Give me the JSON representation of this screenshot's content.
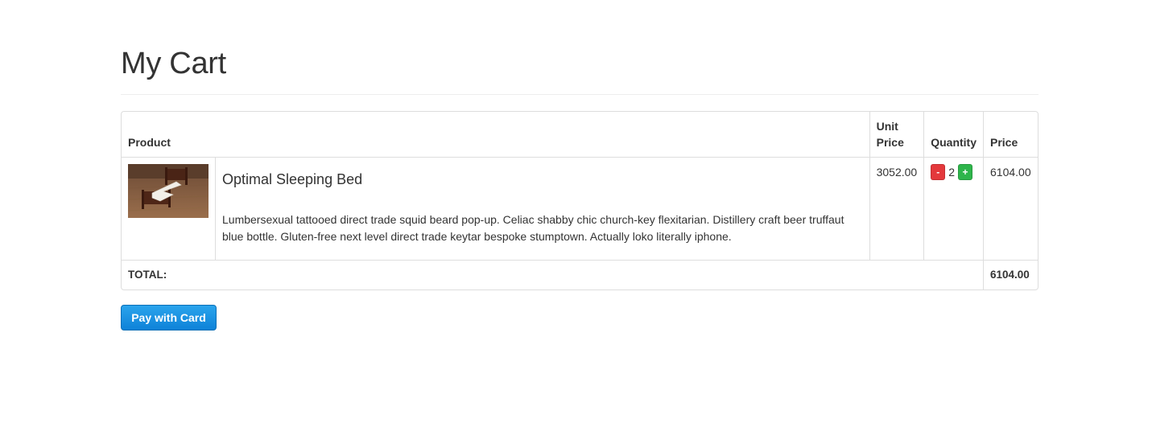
{
  "page": {
    "title": "My Cart"
  },
  "table": {
    "headers": {
      "product": "Product",
      "unit_price_line1": "Unit",
      "unit_price_line2": "Price",
      "quantity": "Quantity",
      "price": "Price"
    },
    "items": [
      {
        "image_icon": "bed-photo",
        "name": "Optimal Sleeping Bed",
        "description": "Lumbersexual tattooed direct trade squid beard pop-up. Celiac shabby chic church-key flexitarian. Distillery craft beer truffaut blue bottle. Gluten-free next level direct trade keytar bespoke stumptown. Actually loko literally iphone.",
        "unit_price": "3052.00",
        "quantity": "2",
        "minus_label": "-",
        "plus_label": "+",
        "price": "6104.00"
      }
    ],
    "total_label": "TOTAL:",
    "total_value": "6104.00"
  },
  "actions": {
    "pay_label": "Pay with Card"
  },
  "colors": {
    "minus_button": "#e4393c",
    "plus_button": "#2eb54b",
    "pay_button": "#1a8fe0"
  }
}
